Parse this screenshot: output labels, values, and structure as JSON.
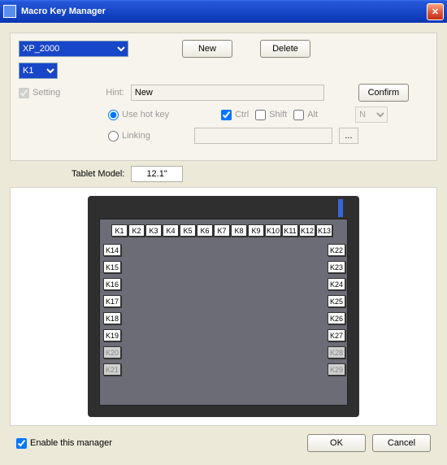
{
  "title": "Macro Key Manager",
  "toolbar": {
    "profile_selected": "XP_2000",
    "key_selected": "K1",
    "new_btn": "New",
    "delete_btn": "Delete"
  },
  "settings": {
    "setting_label": "Setting",
    "hint_label": "Hint:",
    "hint_value": "New",
    "confirm_btn": "Confirm",
    "radio_hotkey": "Use hot key",
    "ctrl_label": "Ctrl",
    "shift_label": "Shift",
    "alt_label": "Alt",
    "mod_select": "N",
    "radio_linking": "Linking",
    "link_value": "",
    "dots": "..."
  },
  "model": {
    "label": "Tablet Model:",
    "value": "12.1\""
  },
  "keys_top": [
    "K1",
    "K2",
    "K3",
    "K4",
    "K5",
    "K6",
    "K7",
    "K8",
    "K9",
    "K10",
    "K11",
    "K12",
    "K13"
  ],
  "keys_left": [
    "K14",
    "K15",
    "K16",
    "K17",
    "K18",
    "K19",
    "K20",
    "K21"
  ],
  "keys_right": [
    "K22",
    "K23",
    "K24",
    "K25",
    "K26",
    "K27",
    "K28",
    "K29"
  ],
  "keys_dim": [
    "K20",
    "K21",
    "K28",
    "K29"
  ],
  "bottom": {
    "enable_label": "Enable this manager",
    "ok": "OK",
    "cancel": "Cancel"
  }
}
